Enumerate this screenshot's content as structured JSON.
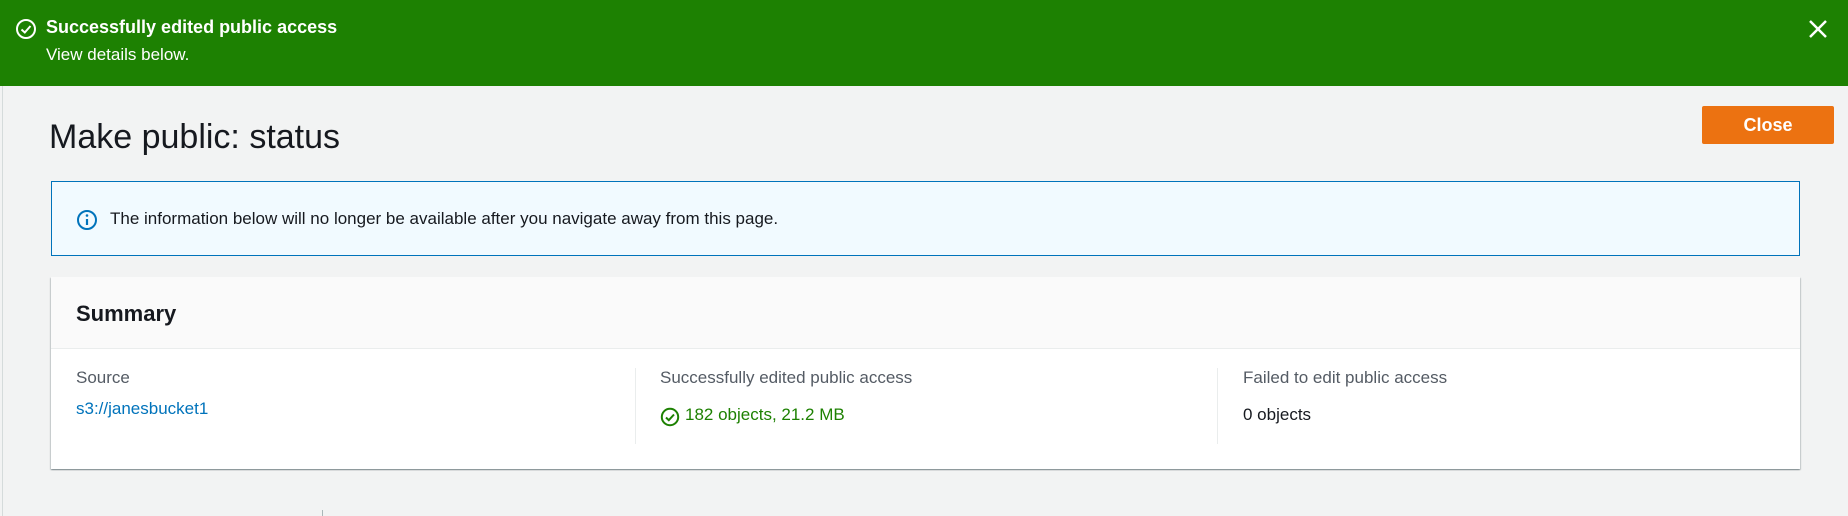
{
  "flash": {
    "title": "Successfully edited public access",
    "subtitle": "View details below.",
    "status_icon": "success-circle-icon",
    "close_icon": "close-icon",
    "color": "#1d8102"
  },
  "page": {
    "title": "Make public: status",
    "close_button": "Close"
  },
  "info": {
    "text": "The information below will no longer be available after you navigate away from this page.",
    "icon": "info-icon"
  },
  "summary": {
    "title": "Summary",
    "source": {
      "label": "Source",
      "value": "s3://janesbucket1"
    },
    "succeeded": {
      "label": "Successfully edited public access",
      "value": "182 objects, 21.2 MB"
    },
    "failed": {
      "label": "Failed to edit public access",
      "value": "0 objects"
    }
  },
  "colors": {
    "accent_orange": "#ec7211",
    "success_green": "#1d8102",
    "link_blue": "#0073bb"
  }
}
